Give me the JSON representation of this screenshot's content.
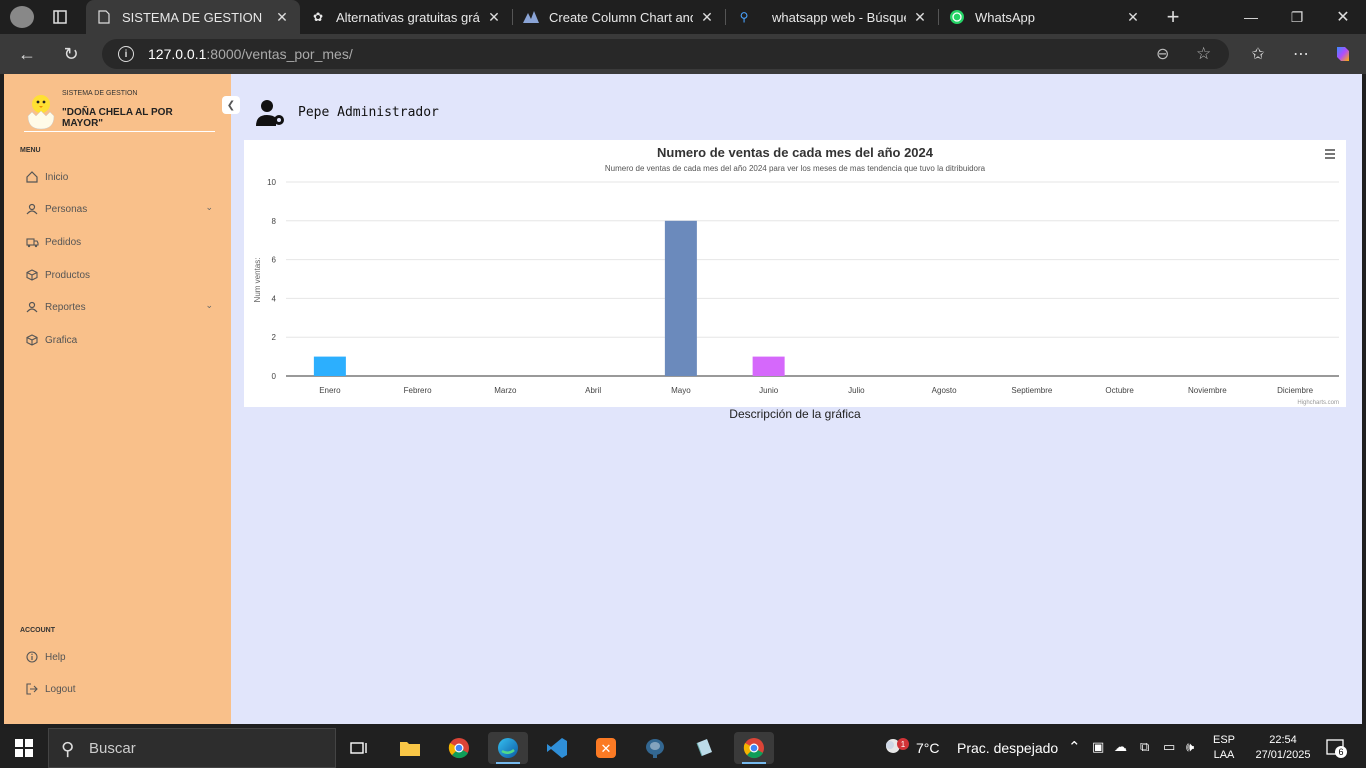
{
  "browser": {
    "tabs": [
      {
        "label": "SISTEMA DE GESTION",
        "icon": "document-icon",
        "active": true
      },
      {
        "label": "Alternativas gratuitas gráfica",
        "icon": "openai-icon"
      },
      {
        "label": "Create Column Chart and Gr",
        "icon": "highcharts-icon"
      },
      {
        "label": "whatsapp web - Búsqueda",
        "icon": "search-icon"
      },
      {
        "label": "WhatsApp",
        "icon": "whatsapp-icon"
      }
    ],
    "url_host": "127.0.0.1",
    "url_path": ":8000/ventas_por_mes/"
  },
  "sidebar": {
    "brand_small": "SISTEMA DE GESTION",
    "brand_name": "\"DOÑA CHELA AL POR MAYOR\"",
    "menu_label": "MENU",
    "items": [
      {
        "label": "Inicio",
        "icon": "home-icon"
      },
      {
        "label": "Personas",
        "icon": "person-icon",
        "expandable": true
      },
      {
        "label": "Pedidos",
        "icon": "truck-icon"
      },
      {
        "label": "Productos",
        "icon": "box-icon"
      },
      {
        "label": "Reportes",
        "icon": "person-icon",
        "expandable": true
      },
      {
        "label": "Grafica",
        "icon": "box-icon"
      }
    ],
    "account_label": "ACCOUNT",
    "account_items": [
      {
        "label": "Help",
        "icon": "info-icon"
      },
      {
        "label": "Logout",
        "icon": "logout-icon"
      }
    ]
  },
  "header": {
    "user_name": "Pepe Administrador"
  },
  "chart_data": {
    "type": "bar",
    "title": "Numero de ventas de cada mes del año 2024",
    "subtitle": "Numero de ventas de cada mes del año 2024 para ver los meses de mas tendencia que tuvo la ditribuidora",
    "ylabel": "Num ventas:",
    "xlabel": "",
    "ylim": [
      0,
      10
    ],
    "yticks": [
      "0",
      "2",
      "4",
      "6",
      "8",
      "10"
    ],
    "categories": [
      "Enero",
      "Febrero",
      "Marzo",
      "Abril",
      "Mayo",
      "Junio",
      "Julio",
      "Agosto",
      "Septiembre",
      "Octubre",
      "Noviembre",
      "Diciembre"
    ],
    "values": [
      1,
      0,
      0,
      0,
      8,
      1,
      0,
      0,
      0,
      0,
      0,
      0
    ],
    "colors": [
      "#2caffe",
      "#544fc5",
      "#00e272",
      "#fe6a35",
      "#6b8abc",
      "#d568fb",
      "#2ee0ca",
      "#fa4b42",
      "#feb56a",
      "#91e8e1",
      "#2caffe",
      "#544fc5"
    ],
    "grid": true,
    "legend": "none",
    "credit": "Highcharts.com",
    "caption": "Descripción de la gráfica"
  },
  "taskbar": {
    "search_placeholder": "Buscar",
    "weather_temp": "7°C",
    "weather_text": "Prac. despejado",
    "weather_badge": "1",
    "lang_top": "ESP",
    "lang_bottom": "LAA",
    "time": "22:54",
    "date": "27/01/2025",
    "notif_count": "6"
  }
}
